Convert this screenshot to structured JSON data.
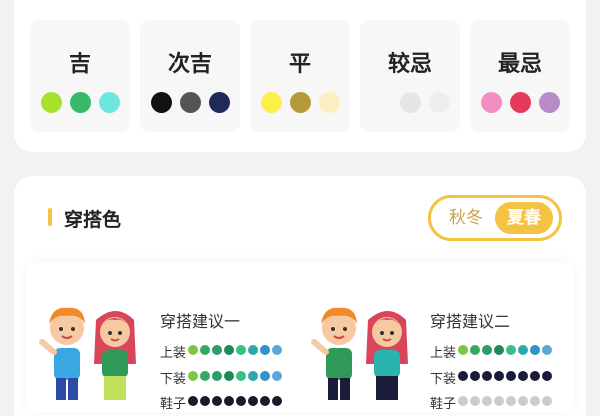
{
  "luck": [
    {
      "label": "吉",
      "colors": [
        "#a6e22a",
        "#39b86b",
        "#6ee6e0"
      ]
    },
    {
      "label": "次吉",
      "colors": [
        "#111111",
        "#555555",
        "#1e2a5a"
      ]
    },
    {
      "label": "平",
      "colors": [
        "#fbf04a",
        "#b59a3a",
        "#fbefbf"
      ]
    },
    {
      "label": "较忌",
      "colors": [
        "#f6f6f6",
        "#e6e6e6",
        "#eeeeee"
      ]
    },
    {
      "label": "最忌",
      "colors": [
        "#f18ec3",
        "#e63a5a",
        "#b98cc8"
      ]
    }
  ],
  "section": {
    "title": "穿搭色"
  },
  "toggle": {
    "left": "秋冬",
    "right": "夏春"
  },
  "suggestions": [
    {
      "title": "穿搭建议一",
      "rows": [
        {
          "label": "上装",
          "colors": [
            "#7bc743",
            "#36a860",
            "#2e9b6a",
            "#1e8a5a",
            "#3bbf88",
            "#2ca9a8",
            "#2d93c8",
            "#5aa8d8"
          ]
        },
        {
          "label": "下装",
          "colors": [
            "#7bc743",
            "#36a860",
            "#2e9b6a",
            "#1e8a5a",
            "#3bbf88",
            "#2ca9a8",
            "#2d93c8",
            "#5aa8d8"
          ]
        },
        {
          "label": "鞋子",
          "colors": [
            "#1a1a2e",
            "#1a1a2e",
            "#1a1a2e",
            "#1a1a2e",
            "#1a1a2e",
            "#1a1a2e",
            "#1a1a2e",
            "#1a1a2e"
          ]
        }
      ]
    },
    {
      "title": "穿搭建议二",
      "rows": [
        {
          "label": "上装",
          "colors": [
            "#7bc743",
            "#36a860",
            "#2e9b6a",
            "#1e8a5a",
            "#3bbf88",
            "#2ca9a8",
            "#2d93c8",
            "#5aa8d8"
          ]
        },
        {
          "label": "下装",
          "colors": [
            "#1b1b3a",
            "#1b1b3a",
            "#1b1b3a",
            "#1b1b3a",
            "#1b1b3a",
            "#1b1b3a",
            "#1b1b3a",
            "#1b1b3a"
          ]
        },
        {
          "label": "鞋子",
          "colors": [
            "#cccccc",
            "#cccccc",
            "#cccccc",
            "#cccccc",
            "#cccccc",
            "#cccccc",
            "#cccccc",
            "#cccccc"
          ]
        }
      ]
    }
  ]
}
